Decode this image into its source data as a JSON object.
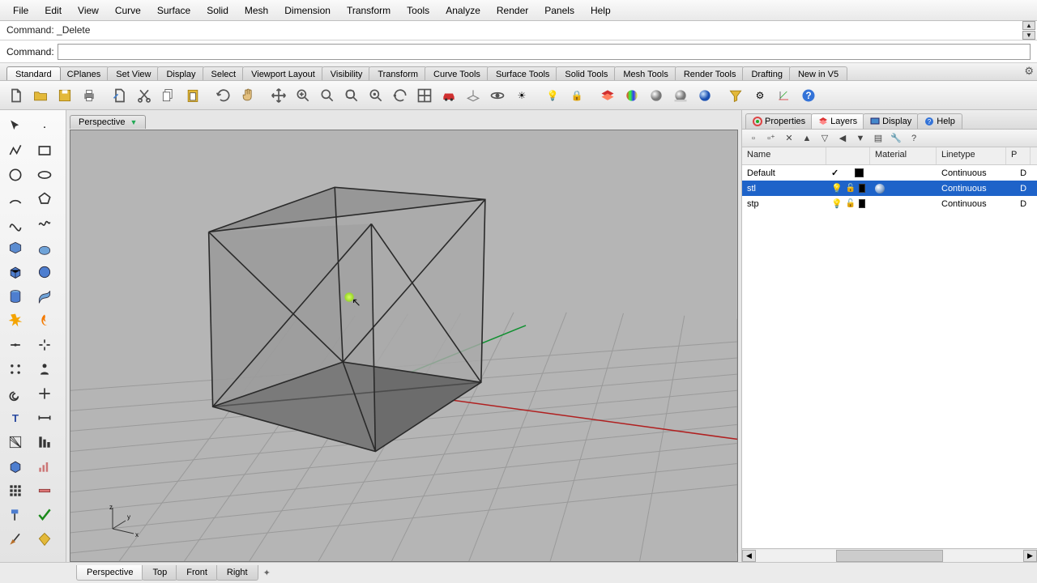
{
  "menu": {
    "items": [
      "File",
      "Edit",
      "View",
      "Curve",
      "Surface",
      "Solid",
      "Mesh",
      "Dimension",
      "Transform",
      "Tools",
      "Analyze",
      "Render",
      "Panels",
      "Help"
    ]
  },
  "command_history": "Command: _Delete",
  "command_label": "Command:",
  "command_value": "",
  "toolbar_tabs": [
    "Standard",
    "CPlanes",
    "Set View",
    "Display",
    "Select",
    "Viewport Layout",
    "Visibility",
    "Transform",
    "Curve Tools",
    "Surface Tools",
    "Solid Tools",
    "Mesh Tools",
    "Render Tools",
    "Drafting",
    "New in V5"
  ],
  "toolbar_active": 0,
  "viewport": {
    "title": "Perspective"
  },
  "panel": {
    "tabs": [
      "Properties",
      "Layers",
      "Display",
      "Help"
    ],
    "active": 1,
    "headers": {
      "name": "Name",
      "material": "Material",
      "linetype": "Linetype",
      "pc": "P"
    },
    "layers": [
      {
        "name": "Default",
        "current": true,
        "on": true,
        "locked": false,
        "color": "#000000",
        "material": false,
        "linetype": "Continuous",
        "pc": "D"
      },
      {
        "name": "stl",
        "current": false,
        "on": true,
        "locked": false,
        "color": "#000000",
        "material": true,
        "linetype": "Continuous",
        "pc": "D",
        "selected": true
      },
      {
        "name": "stp",
        "current": false,
        "on": true,
        "locked": false,
        "color": "#000000",
        "material": false,
        "linetype": "Continuous",
        "pc": "D"
      }
    ]
  },
  "viewtabs": [
    "Perspective",
    "Top",
    "Front",
    "Right"
  ],
  "viewtab_active": 0,
  "axis": {
    "x": "x",
    "y": "y",
    "z": "z"
  }
}
